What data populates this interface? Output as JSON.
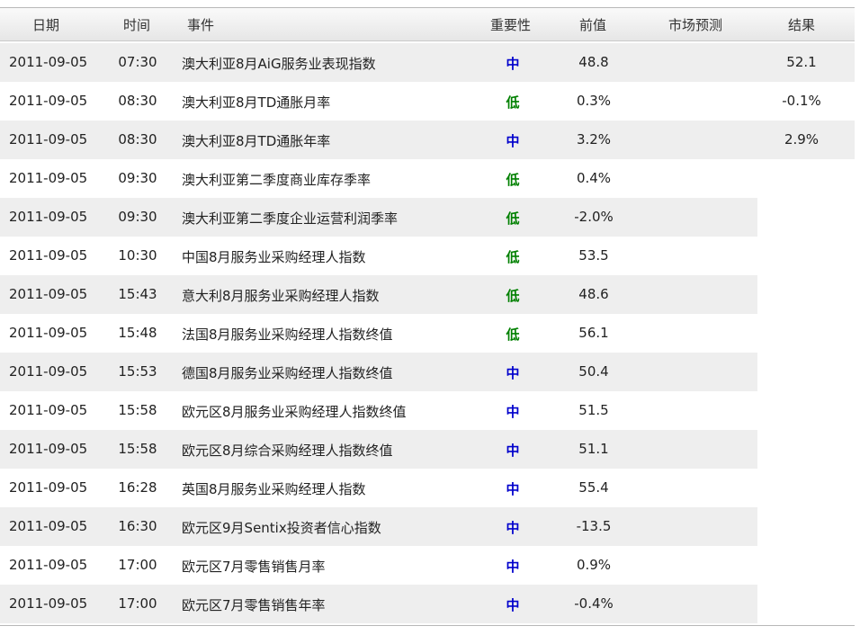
{
  "colors": {
    "row_shade": "#eeeeee",
    "importance_high": "#0000cc",
    "importance_low": "#008000"
  },
  "headers": {
    "date": "日期",
    "time": "时间",
    "event": "事件",
    "importance": "重要性",
    "previous": "前值",
    "forecast": "市场预测",
    "result": "结果"
  },
  "rows": [
    {
      "date": "2011-09-05",
      "time": "07:30",
      "event": "澳大利亚8月AiG服务业表现指数",
      "importance": "中",
      "level": "medium",
      "previous": "48.8",
      "forecast": "",
      "result": "52.1"
    },
    {
      "date": "2011-09-05",
      "time": "08:30",
      "event": "澳大利亚8月TD通胀月率",
      "importance": "低",
      "level": "low",
      "previous": "0.3%",
      "forecast": "",
      "result": "-0.1%"
    },
    {
      "date": "2011-09-05",
      "time": "08:30",
      "event": "澳大利亚8月TD通胀年率",
      "importance": "中",
      "level": "medium",
      "previous": "3.2%",
      "forecast": "",
      "result": "2.9%"
    },
    {
      "date": "2011-09-05",
      "time": "09:30",
      "event": "澳大利亚第二季度商业库存季率",
      "importance": "低",
      "level": "low",
      "previous": "0.4%",
      "forecast": "",
      "result": ""
    },
    {
      "date": "2011-09-05",
      "time": "09:30",
      "event": "澳大利亚第二季度企业运营利润季率",
      "importance": "低",
      "level": "low",
      "previous": "-2.0%",
      "forecast": "",
      "result": ""
    },
    {
      "date": "2011-09-05",
      "time": "10:30",
      "event": "中国8月服务业采购经理人指数",
      "importance": "低",
      "level": "low",
      "previous": "53.5",
      "forecast": "",
      "result": ""
    },
    {
      "date": "2011-09-05",
      "time": "15:43",
      "event": "意大利8月服务业采购经理人指数",
      "importance": "低",
      "level": "low",
      "previous": "48.6",
      "forecast": "",
      "result": ""
    },
    {
      "date": "2011-09-05",
      "time": "15:48",
      "event": "法国8月服务业采购经理人指数终值",
      "importance": "低",
      "level": "low",
      "previous": "56.1",
      "forecast": "",
      "result": ""
    },
    {
      "date": "2011-09-05",
      "time": "15:53",
      "event": "德国8月服务业采购经理人指数终值",
      "importance": "中",
      "level": "medium",
      "previous": "50.4",
      "forecast": "",
      "result": ""
    },
    {
      "date": "2011-09-05",
      "time": "15:58",
      "event": "欧元区8月服务业采购经理人指数终值",
      "importance": "中",
      "level": "medium",
      "previous": "51.5",
      "forecast": "",
      "result": ""
    },
    {
      "date": "2011-09-05",
      "time": "15:58",
      "event": "欧元区8月综合采购经理人指数终值",
      "importance": "中",
      "level": "medium",
      "previous": "51.1",
      "forecast": "",
      "result": ""
    },
    {
      "date": "2011-09-05",
      "time": "16:28",
      "event": "英国8月服务业采购经理人指数",
      "importance": "中",
      "level": "medium",
      "previous": "55.4",
      "forecast": "",
      "result": ""
    },
    {
      "date": "2011-09-05",
      "time": "16:30",
      "event": "欧元区9月Sentix投资者信心指数",
      "importance": "中",
      "level": "medium",
      "previous": "-13.5",
      "forecast": "",
      "result": ""
    },
    {
      "date": "2011-09-05",
      "time": "17:00",
      "event": "欧元区7月零售销售月率",
      "importance": "中",
      "level": "medium",
      "previous": "0.9%",
      "forecast": "",
      "result": ""
    },
    {
      "date": "2011-09-05",
      "time": "17:00",
      "event": "欧元区7月零售销售年率",
      "importance": "中",
      "level": "medium",
      "previous": "-0.4%",
      "forecast": "",
      "result": ""
    }
  ]
}
